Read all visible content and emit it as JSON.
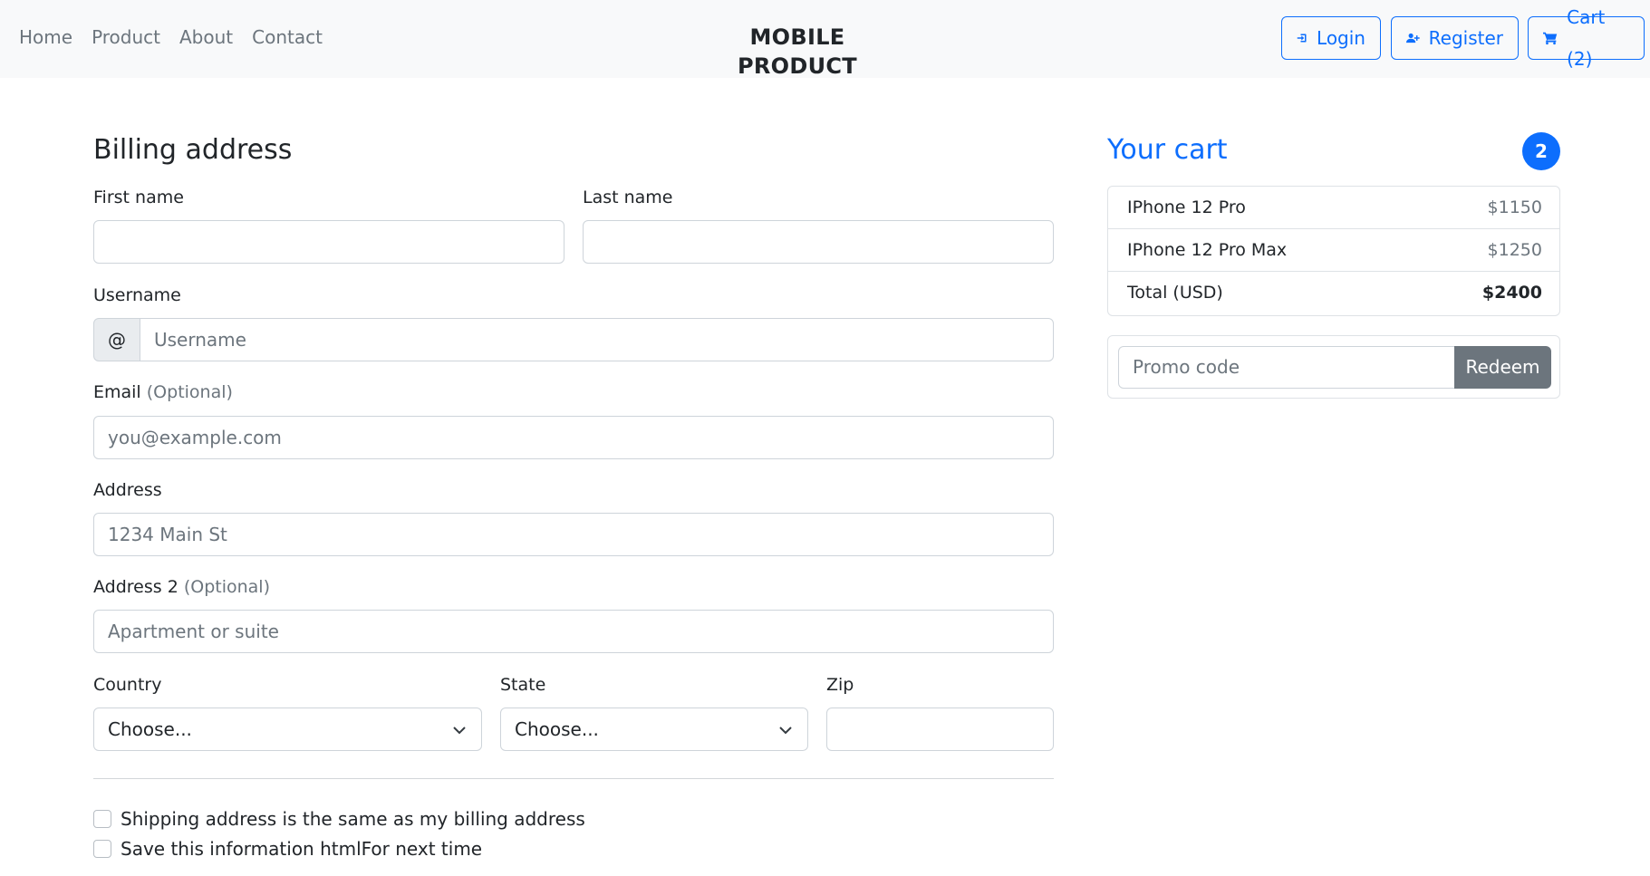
{
  "nav": {
    "items": [
      {
        "label": "Home"
      },
      {
        "label": "Product"
      },
      {
        "label": "About"
      },
      {
        "label": "Contact"
      }
    ],
    "brand": "MOBILE PRODUCT",
    "login_label": "Login",
    "register_label": "Register",
    "cart_label": "Cart (2)"
  },
  "billing": {
    "title": "Billing address",
    "first_name": {
      "label": "First name",
      "value": "",
      "placeholder": ""
    },
    "last_name": {
      "label": "Last name",
      "value": "",
      "placeholder": ""
    },
    "username": {
      "label": "Username",
      "prefix": "@",
      "placeholder": "Username"
    },
    "email": {
      "label": "Email",
      "optional": "(Optional)",
      "placeholder": "you@example.com"
    },
    "address": {
      "label": "Address",
      "placeholder": "1234 Main St"
    },
    "address2": {
      "label": "Address 2",
      "optional": "(Optional)",
      "placeholder": "Apartment or suite"
    },
    "country": {
      "label": "Country",
      "selected": "Choose..."
    },
    "state": {
      "label": "State",
      "selected": "Choose..."
    },
    "zip": {
      "label": "Zip",
      "value": ""
    },
    "checkboxes": [
      {
        "label": "Shipping address is the same as my billing address",
        "checked": false
      },
      {
        "label": "Save this information htmlFor next time",
        "checked": false
      }
    ]
  },
  "cart": {
    "title": "Your cart",
    "count": "2",
    "items": [
      {
        "name": "IPhone 12 Pro",
        "price": "$1150"
      },
      {
        "name": "IPhone 12 Pro Max",
        "price": "$1250"
      }
    ],
    "total": {
      "label": "Total (USD)",
      "value": "$2400"
    },
    "promo": {
      "placeholder": "Promo code",
      "button": "Redeem"
    }
  },
  "colors": {
    "accent": "#0d6efd",
    "muted": "#6c757d",
    "topbar_bg": "#f8f9fa"
  },
  "icons": [
    "sign-in-icon",
    "user-plus-icon",
    "shopping-cart-icon",
    "chevron-down-icon"
  ]
}
